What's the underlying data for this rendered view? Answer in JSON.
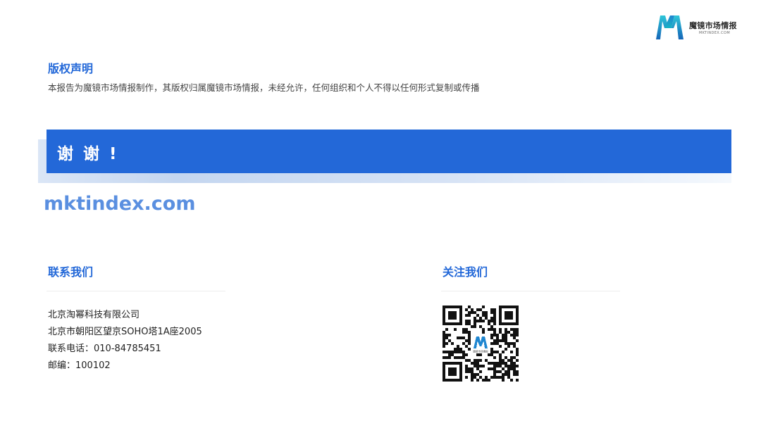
{
  "logo": {
    "name_cn": "魔镜市场情报",
    "name_en": "MKTINDEX.COM",
    "mark_letter": "M",
    "colors": {
      "primary": "#1f8fd6",
      "secondary": "#22b7c9"
    }
  },
  "copyright": {
    "title": "版权声明",
    "text": "本报告为魔镜市场情报制作，其版权归属魔镜市场情报，未经允许，任何组织和个人不得以任何形式复制或传播"
  },
  "banner": {
    "text": "谢 谢 !"
  },
  "website": "mktindex.com",
  "contact": {
    "title": "联系我们",
    "lines": [
      "北京淘幂科技有限公司",
      "北京市朝阳区望京SOHO塔1A座2005",
      "联系电话：010-84785451",
      "邮编：100102"
    ]
  },
  "follow": {
    "title": "关注我们",
    "qr_icon": "qr-code-icon",
    "qr_center_text": "魔镜市场情报"
  },
  "colors": {
    "accent": "#2368d8",
    "website_text": "#5a8fe0"
  }
}
